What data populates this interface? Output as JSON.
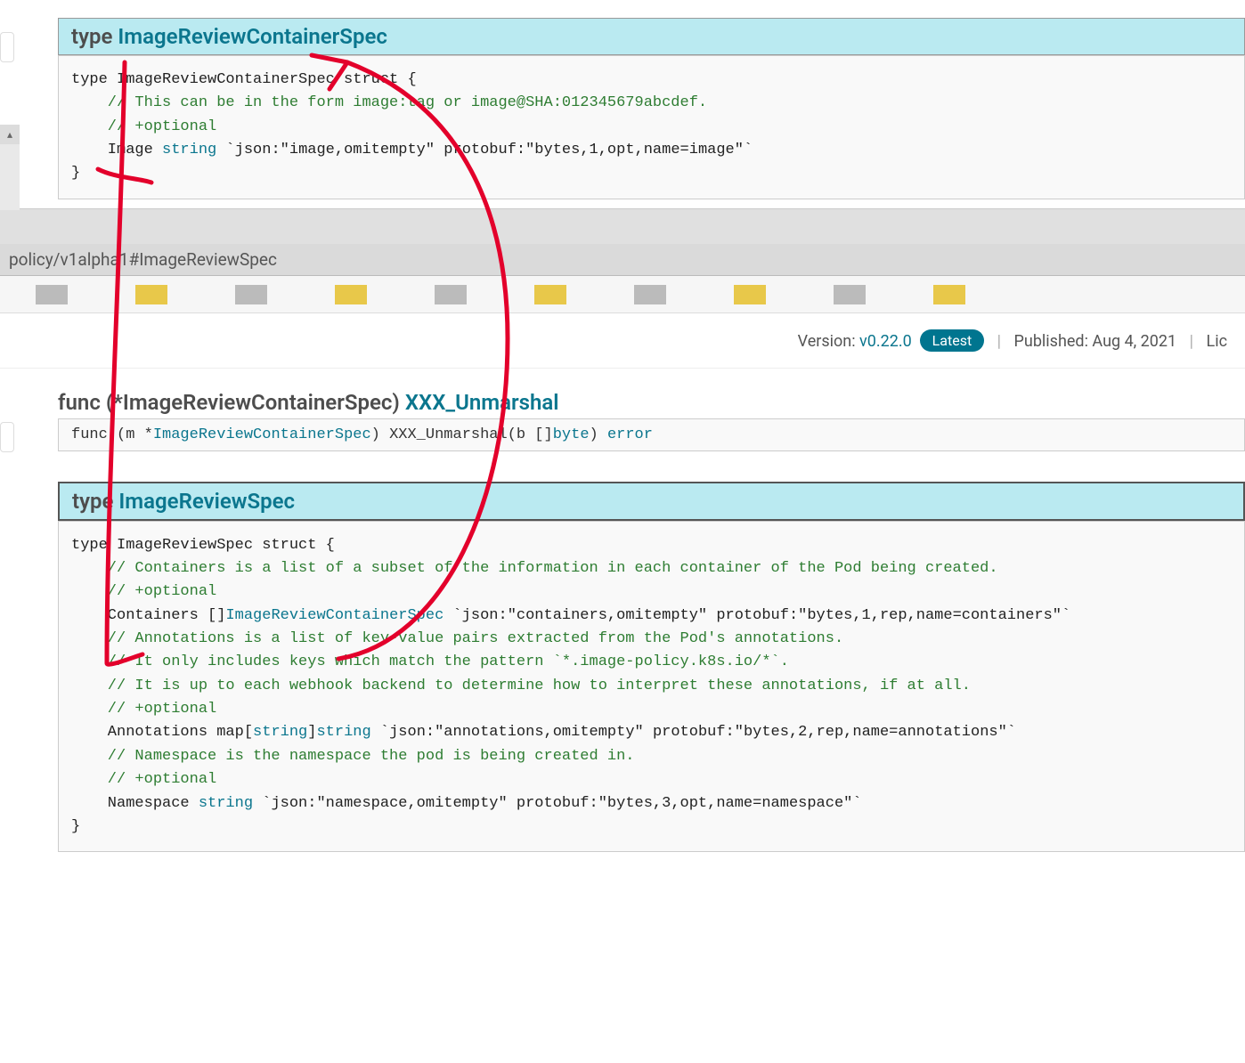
{
  "top": {
    "header_prefix": "type ",
    "header_type": "ImageReviewContainerSpec",
    "code_lines": [
      {
        "t": "plain",
        "v": "type ImageReviewContainerSpec struct {"
      },
      {
        "t": "comment",
        "v": "    // This can be in the form image:tag or image@SHA:012345679abcdef."
      },
      {
        "t": "comment",
        "v": "    // +optional"
      },
      {
        "t": "field",
        "pre": "    Image ",
        "kw": "string",
        "post": " `json:\"image,omitempty\" protobuf:\"bytes,1,opt,name=image\"`"
      },
      {
        "t": "plain",
        "v": "}"
      }
    ]
  },
  "url_fragment": "policy/v1alpha1#ImageReviewSpec",
  "metadata": {
    "version_label": "Version: ",
    "version_value": "v0.22.0",
    "latest": "Latest",
    "published_label": "Published: ",
    "published_value": "Aug 4, 2021",
    "license_label": "Lic"
  },
  "func": {
    "heading_prefix": "func (*ImageReviewContainerSpec) ",
    "heading_link": "XXX_Unmarshal",
    "sig_pre": "func (m *",
    "sig_type": "ImageReviewContainerSpec",
    "sig_mid": ") XXX_Unmarshal(b []",
    "sig_kw1": "byte",
    "sig_mid2": ") ",
    "sig_kw2": "error"
  },
  "bottom": {
    "header_prefix": "type ",
    "header_type": "ImageReviewSpec",
    "code_lines": [
      {
        "t": "plain",
        "v": "type ImageReviewSpec struct {"
      },
      {
        "t": "comment",
        "v": "    // Containers is a list of a subset of the information in each container of the Pod being created."
      },
      {
        "t": "comment",
        "v": "    // +optional"
      },
      {
        "t": "field_link",
        "pre": "    Containers []",
        "link": "ImageReviewContainerSpec",
        "post": " `json:\"containers,omitempty\" protobuf:\"bytes,1,rep,name=containers\"`"
      },
      {
        "t": "comment",
        "v": "    // Annotations is a list of key-value pairs extracted from the Pod's annotations."
      },
      {
        "t": "comment",
        "v": "    // It only includes keys which match the pattern `*.image-policy.k8s.io/*`."
      },
      {
        "t": "comment",
        "v": "    // It is up to each webhook backend to determine how to interpret these annotations, if at all."
      },
      {
        "t": "comment",
        "v": "    // +optional"
      },
      {
        "t": "field2",
        "pre": "    Annotations map[",
        "kw1": "string",
        "mid": "]",
        "kw2": "string",
        "post": " `json:\"annotations,omitempty\" protobuf:\"bytes,2,rep,name=annotations\"`"
      },
      {
        "t": "comment",
        "v": "    // Namespace is the namespace the pod is being created in."
      },
      {
        "t": "comment",
        "v": "    // +optional"
      },
      {
        "t": "field",
        "pre": "    Namespace ",
        "kw": "string",
        "post": " `json:\"namespace,omitempty\" protobuf:\"bytes,3,opt,name=namespace\"`"
      },
      {
        "t": "plain",
        "v": "}"
      }
    ]
  }
}
